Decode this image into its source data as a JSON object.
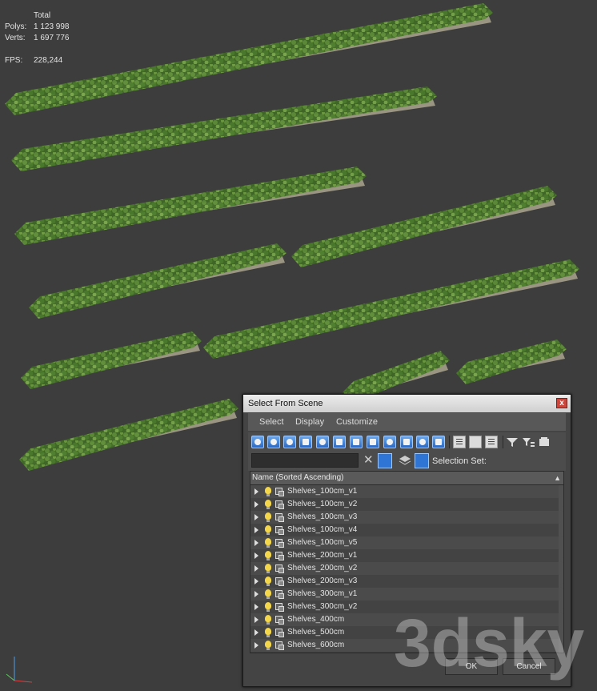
{
  "stats": {
    "header": "Total",
    "rows": [
      {
        "label": "Polys:",
        "value": "1 123 998"
      },
      {
        "label": "Verts:",
        "value": "1 697 776"
      },
      {
        "label": "FPS:",
        "value": "228,244"
      }
    ]
  },
  "dialog": {
    "title": "Select From Scene",
    "close": "x",
    "menu": [
      "Select",
      "Display",
      "Customize"
    ],
    "selection_set_label": "Selection Set:",
    "search": {
      "value": "",
      "placeholder": ""
    },
    "list_header": "Name (Sorted Ascending)",
    "sort_arrow": "▲",
    "items": [
      "Shelves_100cm_v1",
      "Shelves_100cm_v2",
      "Shelves_100cm_v3",
      "Shelves_100cm_v4",
      "Shelves_100cm_v5",
      "Shelves_200cm_v1",
      "Shelves_200cm_v2",
      "Shelves_200cm_v3",
      "Shelves_300cm_v1",
      "Shelves_300cm_v2",
      "Shelves_400cm",
      "Shelves_500cm",
      "Shelves_600cm"
    ],
    "ok_label": "OK",
    "cancel_label": "Cancel"
  },
  "watermark": "3dsky",
  "icons": {
    "toolbar_blue": [
      "sphere-icon",
      "shapes-icon",
      "light-icon",
      "camera-icon",
      "helper-icon",
      "spacewarp-icon",
      "group-icon",
      "xref-icon",
      "bone-icon",
      "container-icon",
      "frozen-icon",
      "hidden-icon"
    ],
    "toolbar_gray": [
      "select-all-icon",
      "select-none-icon",
      "select-invert-icon",
      "filter-icon",
      "filter-settings-icon",
      "pin-icon"
    ]
  },
  "colors": {
    "viewport_bg": "#3d3d3d",
    "stats_text": "#e8d34a",
    "accent_blue": "#2f75d6",
    "foliage": "#4e7a2e"
  }
}
